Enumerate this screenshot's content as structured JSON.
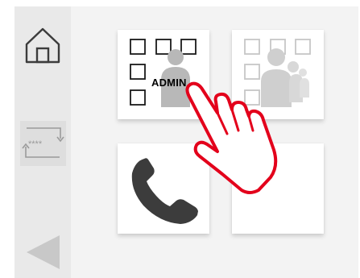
{
  "sidebar": {
    "home_icon": "home-icon",
    "pin_icon": "pin-reset-icon",
    "pin_mask": "****",
    "back_icon": "back-arrow-icon"
  },
  "tiles": [
    {
      "id": "admin",
      "icon": "admin-grid-person-icon",
      "label": "ADMIN",
      "state": "enabled"
    },
    {
      "id": "users",
      "icon": "users-grid-icon",
      "state": "disabled"
    },
    {
      "id": "call",
      "icon": "phone-icon",
      "state": "enabled"
    },
    {
      "id": "empty",
      "state": "empty"
    }
  ],
  "overlay": {
    "icon": "pointing-hand-icon"
  },
  "colors": {
    "accent_red": "#e3001b",
    "sidebar_bg": "#e9e9e9",
    "panel_bg": "#f3f3f3",
    "icon_dark": "#3c3c3c",
    "icon_disabled": "#c6c6c6"
  }
}
